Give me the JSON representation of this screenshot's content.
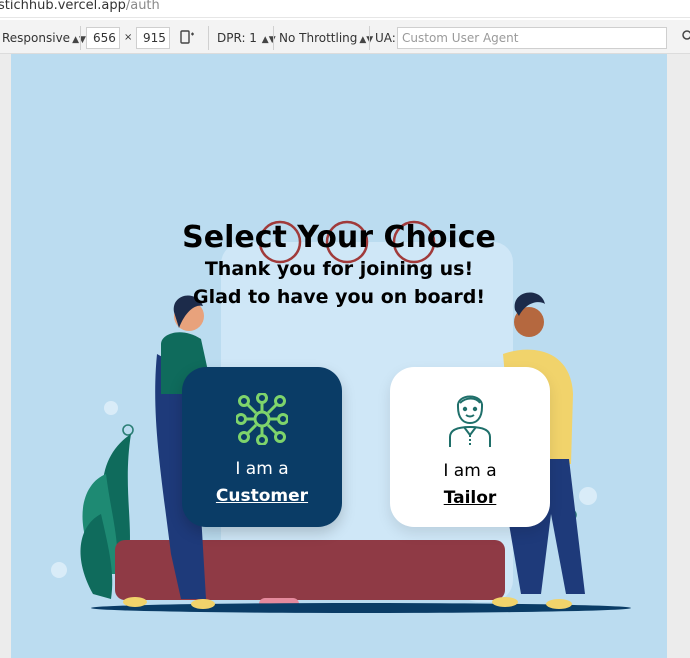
{
  "browser": {
    "host": "stichhub.vercel.app",
    "path": "/auth"
  },
  "devtools": {
    "device": "Responsive",
    "width": "656",
    "times": "×",
    "height": "915",
    "dpr": "DPR: 1",
    "throttling": "No Throttling",
    "ua_label": "UA:",
    "ua_placeholder": "Custom User Agent"
  },
  "page": {
    "title": "Select Your Choice",
    "subtitle_line1": "Thank you for joining us!",
    "subtitle_line2": "Glad to have you on board!",
    "background_color": "#bbdcf0",
    "options": [
      {
        "prefix": "I am a",
        "role": "Customer",
        "icon": "network-people-icon",
        "bg": "#0a3c66"
      },
      {
        "prefix": "I am a",
        "role": "Tailor",
        "icon": "tailor-person-icon",
        "bg": "#ffffff"
      }
    ]
  }
}
